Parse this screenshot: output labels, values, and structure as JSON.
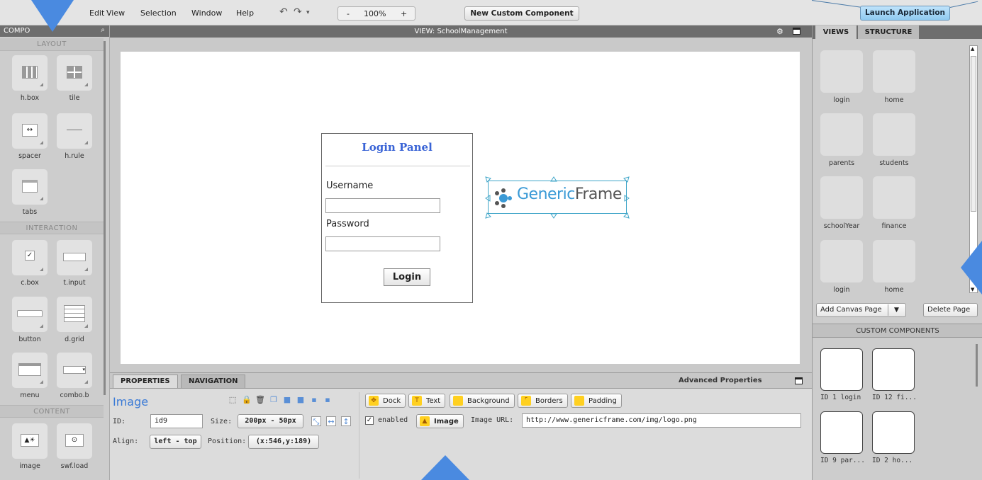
{
  "menu": {
    "items": [
      "Edit",
      "View",
      "Selection",
      "Window",
      "Help"
    ],
    "zoom": {
      "minus": "-",
      "value": "100%",
      "plus": "+"
    },
    "new_component": "New Custom Component",
    "launch": "Launch Application"
  },
  "components_panel": {
    "title": "COMPO",
    "sections": [
      "LAYOUT",
      "INTERACTION",
      "CONTENT"
    ],
    "items": [
      "h.box",
      "tile",
      "spacer",
      "h.rule",
      "tabs",
      "c.box",
      "t.input",
      "button",
      "d.grid",
      "menu",
      "combo.b",
      "image",
      "swf.load"
    ]
  },
  "view": {
    "title": "VIEW: SchoolManagement"
  },
  "canvas": {
    "login_panel": {
      "title": "Login Panel",
      "username_label": "Username",
      "password_label": "Password",
      "login_button": "Login"
    },
    "logo": {
      "part1": "Generic",
      "part2": "Frame"
    }
  },
  "properties": {
    "tabs": [
      "PROPERTIES",
      "NAVIGATION"
    ],
    "advanced": "Advanced Properties",
    "component_type": "Image",
    "id_label": "ID:",
    "id_value": "id9",
    "size_label": "Size:",
    "size_value": "200px - 50px",
    "align_label": "Align:",
    "align_value": "left - top",
    "position_label": "Position:",
    "position_value": "(x:546,y:189)",
    "style_buttons": [
      "Dock",
      "Text",
      "Background",
      "Borders",
      "Padding"
    ],
    "enabled_label": "enabled",
    "image_button": "Image",
    "image_url_label": "Image URL:",
    "image_url": "http://www.genericframe.com/img/logo.png"
  },
  "right_panel": {
    "tabs": [
      "VIEWS",
      "STRUCTURE"
    ],
    "views": [
      "login",
      "home",
      "parents",
      "students",
      "schoolYear",
      "finance",
      "login",
      "home"
    ],
    "add_canvas_page": "Add Canvas Page",
    "delete_page": "Delete Page",
    "custom_components_title": "CUSTOM COMPONENTS",
    "custom_components": [
      "ID 1 login",
      "ID 12 fi...",
      "ID 9 par...",
      "ID 2 ho..."
    ]
  },
  "colors": {
    "accent": "#3a7ad6",
    "launch": "#9fd3f5",
    "arrow": "#4a8ae0"
  }
}
